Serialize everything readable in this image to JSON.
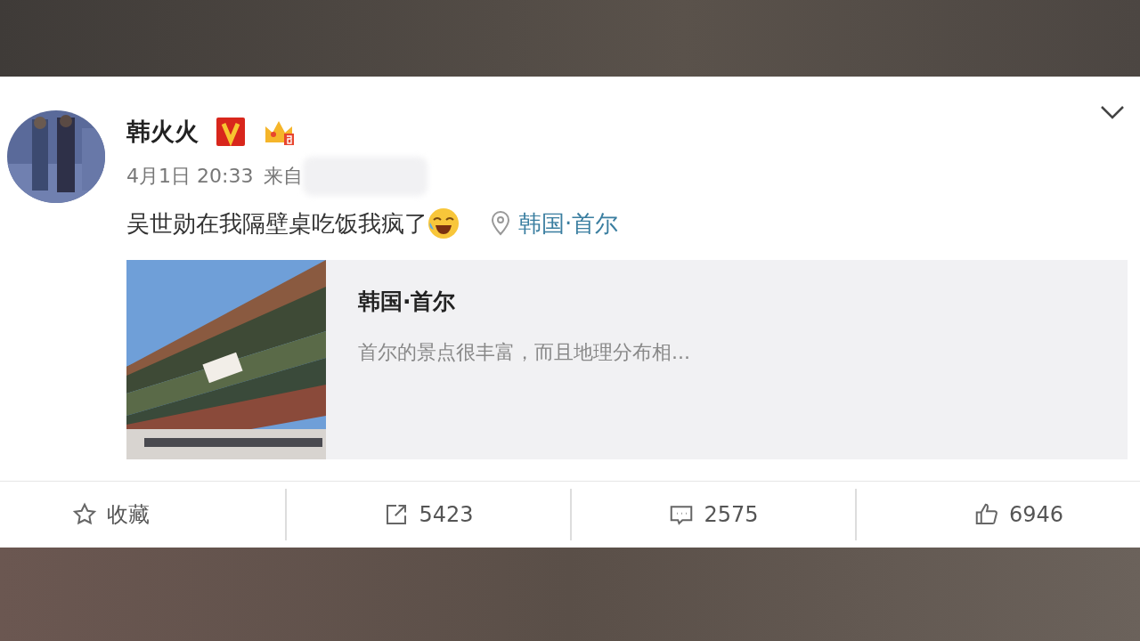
{
  "post": {
    "author": "韩火火",
    "time": "4月1日 20:33",
    "source_label": "来自",
    "text": "吴世勋在我隔壁桌吃饭我疯了",
    "location": "韩国·首尔",
    "link_card": {
      "title": "韩国·首尔",
      "description": "首尔的景点很丰富，而且地理分布相..."
    },
    "actions": [
      {
        "kind": "favorite",
        "label": "收藏"
      },
      {
        "kind": "repost",
        "label": "5423"
      },
      {
        "kind": "comment",
        "label": "2575"
      },
      {
        "kind": "like",
        "label": "6946"
      }
    ]
  }
}
